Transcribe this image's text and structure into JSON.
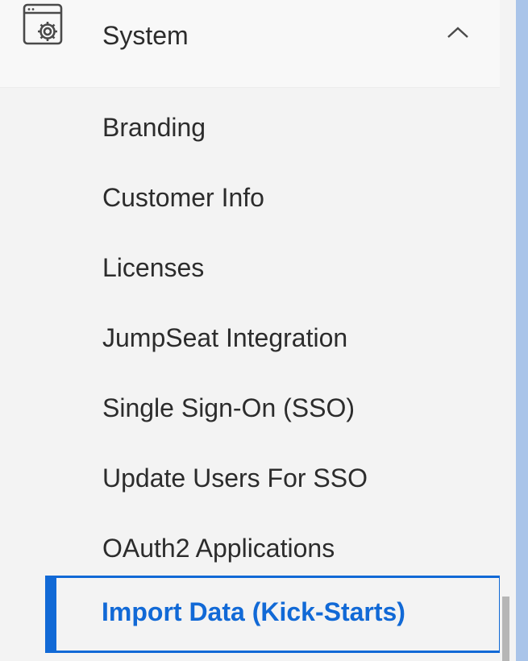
{
  "section": {
    "title": "System",
    "icon": "window-gear-icon",
    "toggle_icon": "chevron-up-icon",
    "expanded": true
  },
  "nav": {
    "items": [
      {
        "label": "Branding"
      },
      {
        "label": "Customer Info"
      },
      {
        "label": "Licenses"
      },
      {
        "label": "JumpSeat Integration"
      },
      {
        "label": "Single Sign-On (SSO)"
      },
      {
        "label": "Update Users For SSO"
      },
      {
        "label": "OAuth2 Applications"
      }
    ],
    "active": {
      "label": "Import Data (Kick-Starts)"
    }
  },
  "colors": {
    "accent": "#1169d6",
    "text": "#2c2c2c",
    "background": "#f3f3f3"
  }
}
